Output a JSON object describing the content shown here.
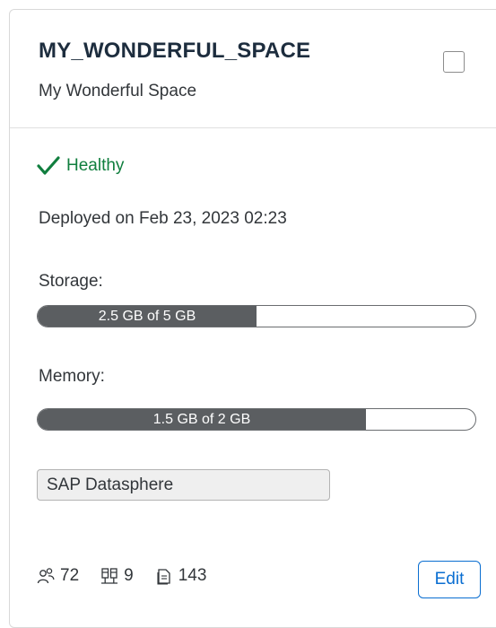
{
  "space": {
    "id": "MY_WONDERFUL_SPACE",
    "name": "My Wonderful Space"
  },
  "status": {
    "label": "Healthy",
    "icon": "check-icon",
    "color": "#107e3e"
  },
  "deployed": "Deployed on Feb 23, 2023 02:23",
  "storage": {
    "label": "Storage:",
    "text": "2.5 GB of 5 GB",
    "fraction": 0.5
  },
  "memory": {
    "label": "Memory:",
    "text": "1.5 GB of 2 GB",
    "fraction": 0.75
  },
  "tag": "SAP Datasphere",
  "footer": {
    "users": "72",
    "connections": "9",
    "objects": "143",
    "icons": [
      "users-icon",
      "connections-icon",
      "objects-icon"
    ]
  },
  "edit_label": "Edit",
  "colors": {
    "accent": "#0a6ed1",
    "bar_fill": "#5b5e61"
  }
}
